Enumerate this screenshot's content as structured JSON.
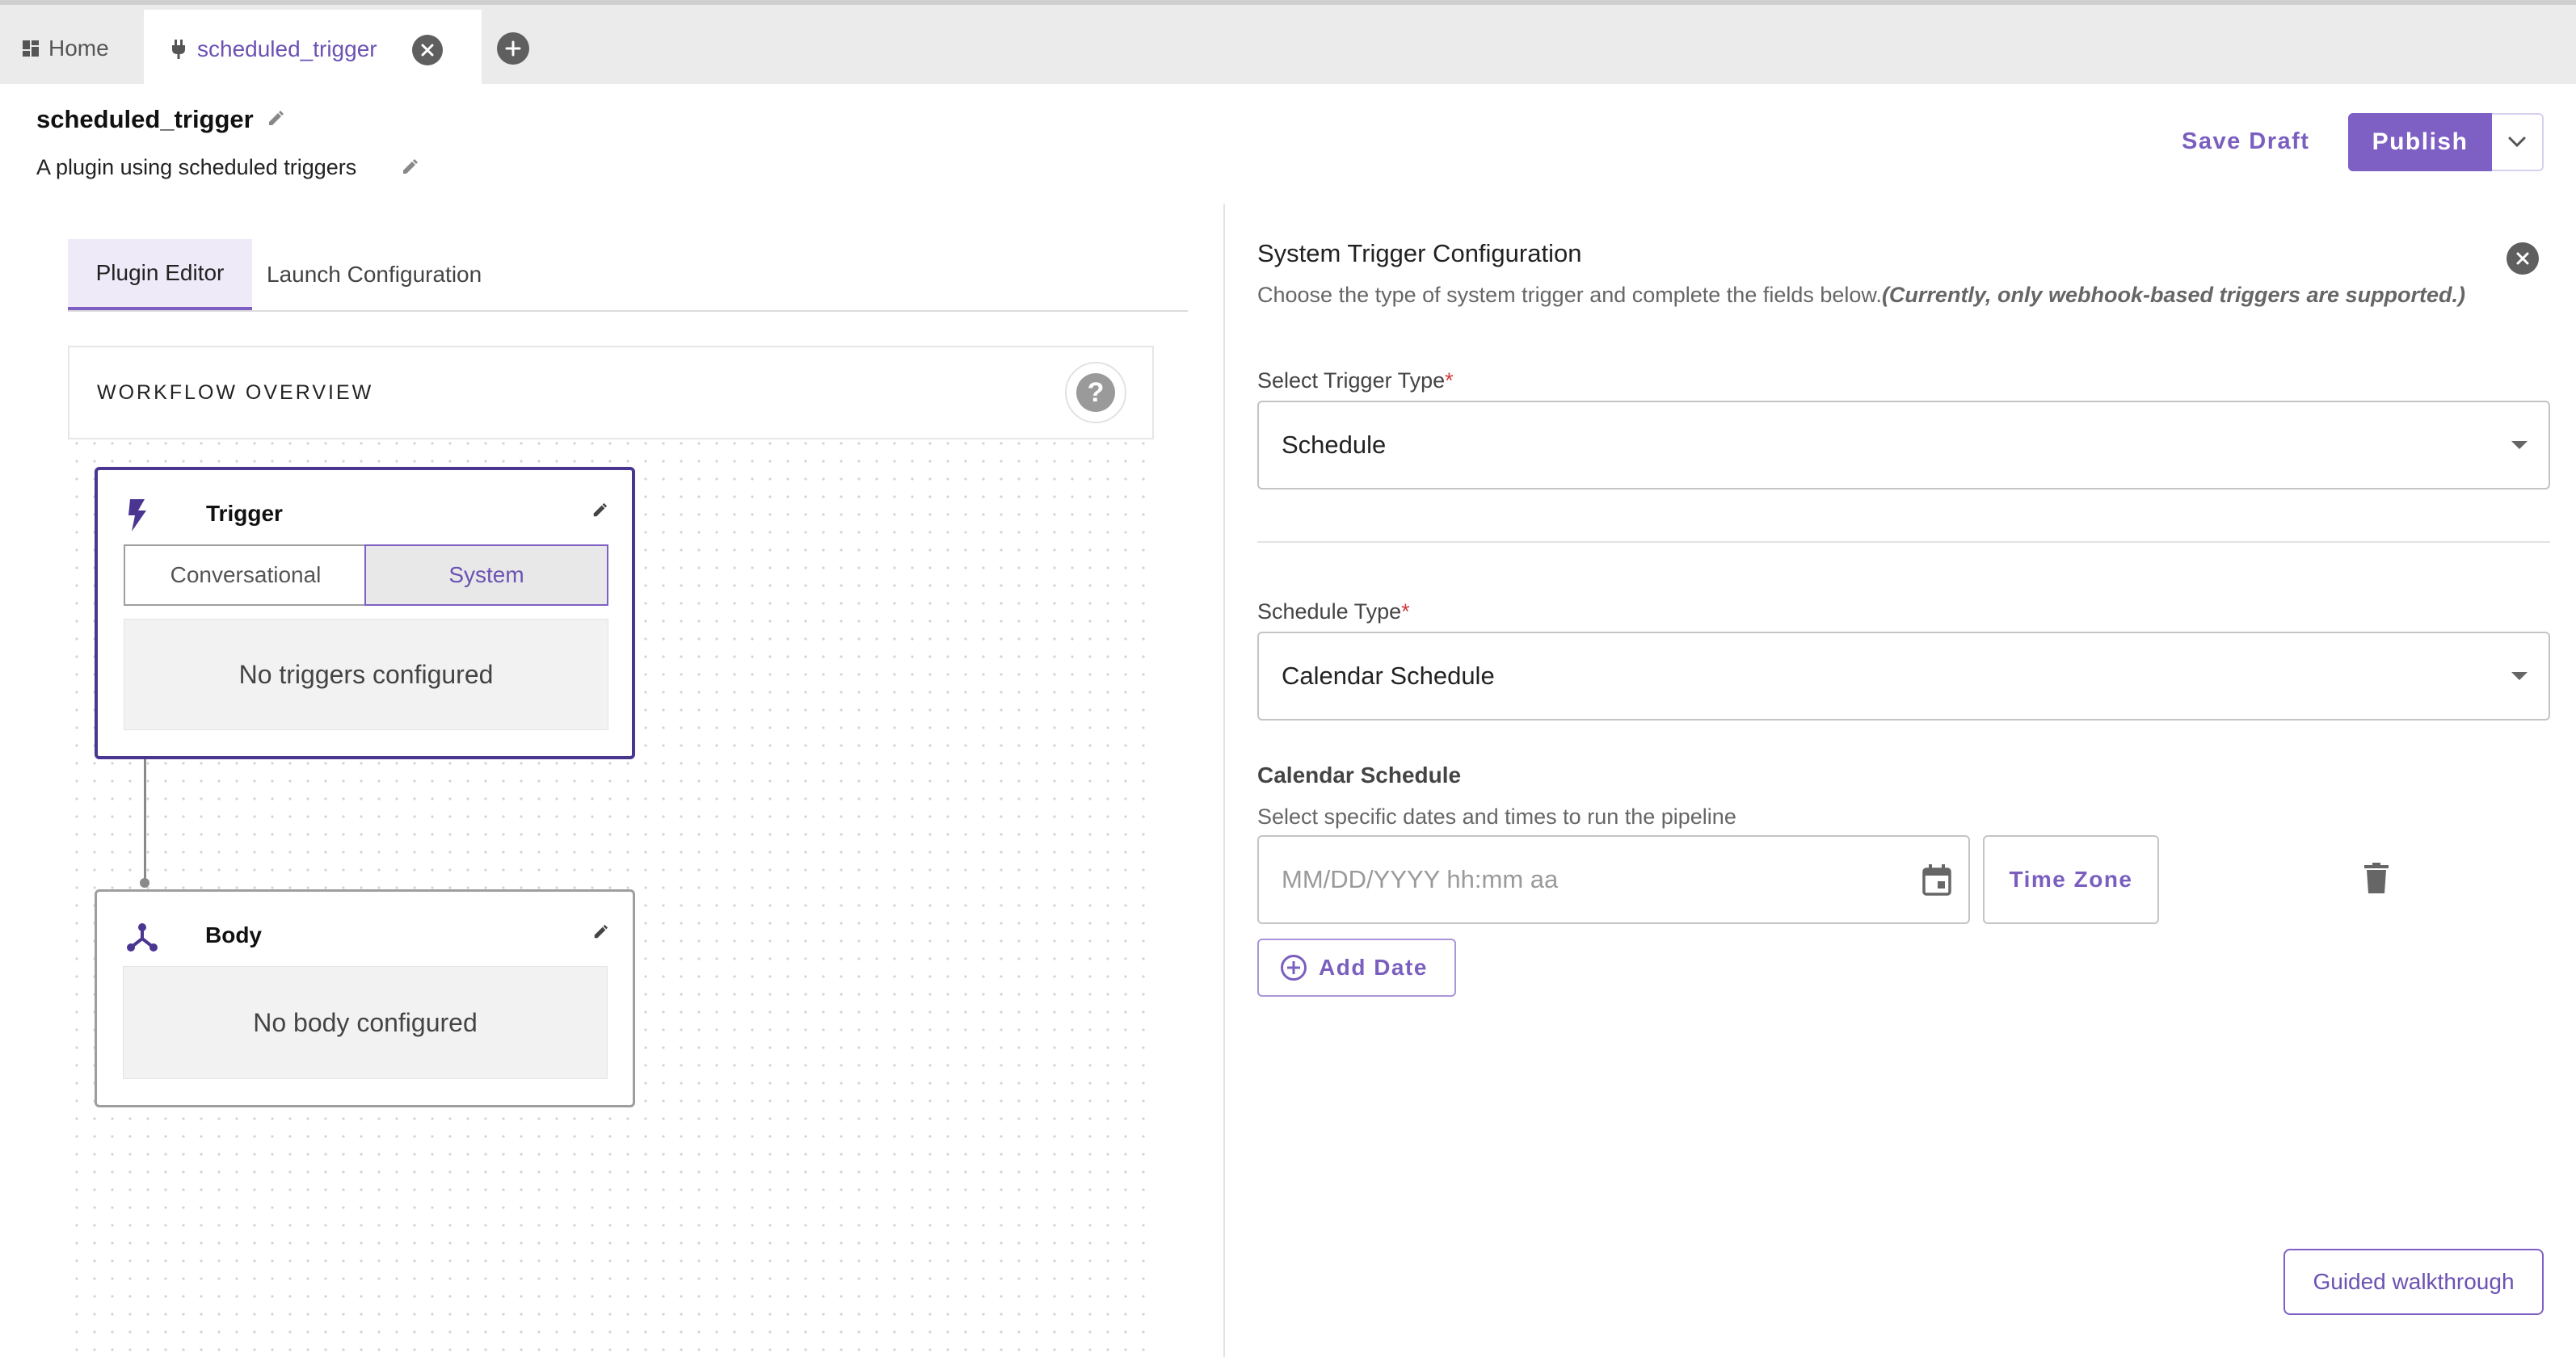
{
  "tabs": {
    "home_label": "Home",
    "active_label": "scheduled_trigger"
  },
  "header": {
    "title": "scheduled_trigger",
    "subtitle": "A plugin using scheduled triggers",
    "save_draft": "Save Draft",
    "publish": "Publish"
  },
  "editor": {
    "tab_plugin": "Plugin Editor",
    "tab_launch": "Launch Configuration",
    "overview_label": "WORKFLOW OVERVIEW",
    "trigger_node": {
      "title": "Trigger",
      "seg_conversational": "Conversational",
      "seg_system": "System",
      "empty": "No triggers configured"
    },
    "body_node": {
      "title": "Body",
      "empty": "No body configured"
    }
  },
  "config": {
    "title": "System Trigger Configuration",
    "desc": "Choose the type of system trigger and complete the fields below.",
    "desc_note": "(Currently, only webhook-based triggers are supported.)",
    "trigger_type_label": "Select Trigger Type",
    "trigger_type_value": "Schedule",
    "schedule_type_label": "Schedule Type",
    "schedule_type_value": "Calendar Schedule",
    "required_mark": "*",
    "calendar_label": "Calendar Schedule",
    "calendar_desc": "Select specific dates and times to run the pipeline",
    "date_placeholder": "MM/DD/YYYY hh:mm aa",
    "time_zone": "Time Zone",
    "add_date": "Add Date"
  },
  "guided_walkthrough": "Guided walkthrough",
  "colors": {
    "accent": "#7e60c4",
    "accent_dark": "#4a3591",
    "required": "#d23a3a"
  }
}
